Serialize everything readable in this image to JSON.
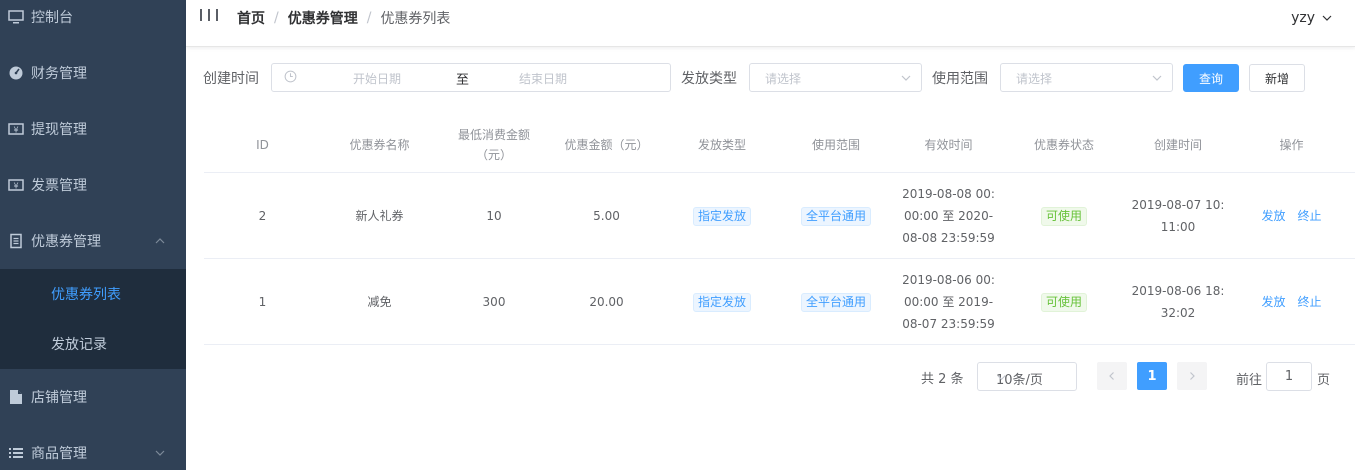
{
  "sidebar": {
    "items": [
      {
        "label": "控制台",
        "icon": "monitor-icon"
      },
      {
        "label": "财务管理",
        "icon": "dashboard-icon"
      },
      {
        "label": "提现管理",
        "icon": "money-icon"
      },
      {
        "label": "发票管理",
        "icon": "invoice-icon"
      },
      {
        "label": "优惠券管理",
        "icon": "document-icon",
        "expanded": true
      },
      {
        "label": "店铺管理",
        "icon": "file-icon"
      },
      {
        "label": "商品管理",
        "icon": "list-icon"
      }
    ],
    "sub_items": [
      {
        "label": "优惠券列表",
        "active": true
      },
      {
        "label": "发放记录",
        "active": false
      }
    ],
    "colors": {
      "background": "#304156",
      "submenu_background": "#1f2d3d",
      "text": "#bfcbd9",
      "active": "#409eff"
    }
  },
  "header": {
    "breadcrumb": [
      "首页",
      "优惠券管理",
      "优惠券列表"
    ],
    "user": "yzy"
  },
  "filters": {
    "created_time_label": "创建时间",
    "start_placeholder": "开始日期",
    "range_separator": "至",
    "end_placeholder": "结束日期",
    "issue_type_label": "发放类型",
    "issue_type_placeholder": "请选择",
    "scope_label": "使用范围",
    "scope_placeholder": "请选择",
    "query_button": "查询",
    "add_button": "新增"
  },
  "table": {
    "columns": [
      "ID",
      "优惠券名称",
      "最低消费金额（元）",
      "优惠金额（元）",
      "发放类型",
      "使用范围",
      "有效时间",
      "优惠券状态",
      "创建时间",
      "操作"
    ],
    "rows": [
      {
        "id": "2",
        "name": "新人礼券",
        "min_spend": "10",
        "discount": "5.00",
        "issue_type": "指定发放",
        "scope": "全平台通用",
        "valid_time": "2019-08-08 00:00:00 至 2020-08-08 23:59:59",
        "status": "可使用",
        "created": "2019-08-07 10:11:00",
        "actions": [
          "发放",
          "终止"
        ]
      },
      {
        "id": "1",
        "name": "减免",
        "min_spend": "300",
        "discount": "20.00",
        "issue_type": "指定发放",
        "scope": "全平台通用",
        "valid_time": "2019-08-06 00:00:00 至 2019-08-07 23:59:59",
        "status": "可使用",
        "created": "2019-08-06 18:32:02",
        "actions": [
          "发放",
          "终止"
        ]
      }
    ]
  },
  "pagination": {
    "total_text": "共 2 条",
    "page_size": "10条/页",
    "current_page": "1",
    "goto_label": "前往",
    "goto_value": "1",
    "page_suffix": "页"
  }
}
